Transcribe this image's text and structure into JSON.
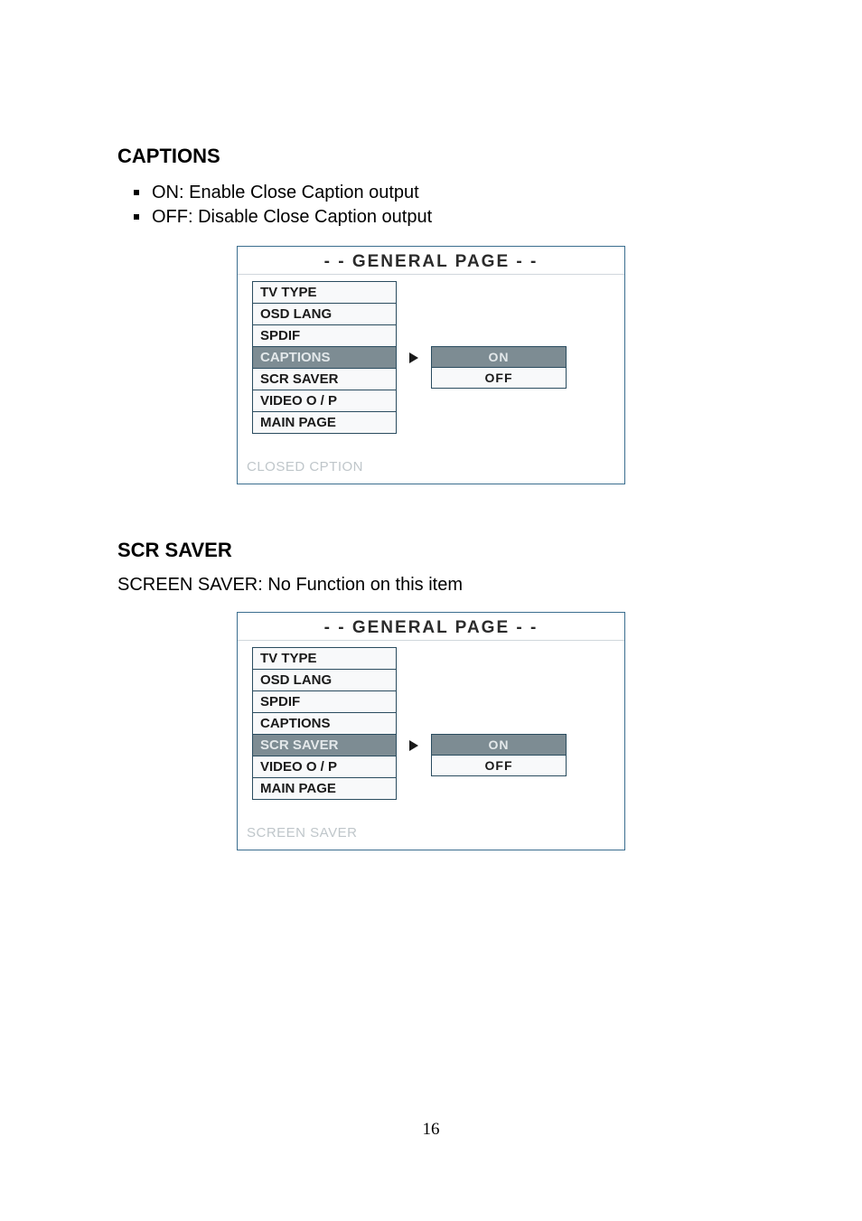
{
  "section1": {
    "heading": "CAPTIONS",
    "bullets": [
      "ON: Enable Close Caption output",
      "OFF: Disable Close Caption output"
    ],
    "osd": {
      "title": "- -   GENERAL  PAGE   - -",
      "menu": [
        {
          "label": "TV TYPE",
          "selected": false
        },
        {
          "label": "OSD LANG",
          "selected": false
        },
        {
          "label": "SPDIF",
          "selected": false
        },
        {
          "label": "CAPTIONS",
          "selected": true
        },
        {
          "label": "SCR SAVER",
          "selected": false
        },
        {
          "label": "VIDEO O / P",
          "selected": false
        },
        {
          "label": "MAIN PAGE",
          "selected": false
        }
      ],
      "arrow_row_index": 3,
      "options": [
        {
          "label": "ON",
          "selected": true
        },
        {
          "label": "OFF",
          "selected": false
        }
      ],
      "status": "CLOSED CPTION"
    }
  },
  "section2": {
    "heading": "SCR SAVER",
    "body": "SCREEN SAVER: No Function on this item",
    "osd": {
      "title": "- -   GENERAL  PAGE   - -",
      "menu": [
        {
          "label": "TV TYPE",
          "selected": false
        },
        {
          "label": "OSD LANG",
          "selected": false
        },
        {
          "label": "SPDIF",
          "selected": false
        },
        {
          "label": "CAPTIONS",
          "selected": false
        },
        {
          "label": "SCR SAVER",
          "selected": true
        },
        {
          "label": "VIDEO O / P",
          "selected": false
        },
        {
          "label": "MAIN PAGE",
          "selected": false
        }
      ],
      "arrow_row_index": 4,
      "options": [
        {
          "label": "ON",
          "selected": true
        },
        {
          "label": "OFF",
          "selected": false
        }
      ],
      "status": "SCREEN SAVER"
    }
  },
  "page_number": "16"
}
